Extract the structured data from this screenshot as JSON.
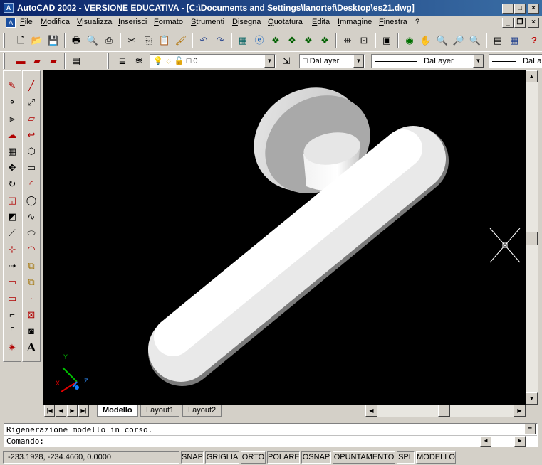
{
  "window": {
    "title": "AutoCAD 2002 - VERSIONE EDUCATIVA - [C:\\Documents and Settings\\lanortef\\Desktop\\es21.dwg]",
    "app_icon": "A"
  },
  "menu": [
    "File",
    "Modifica",
    "Visualizza",
    "Inserisci",
    "Formato",
    "Strumenti",
    "Disegna",
    "Quotatura",
    "Edita",
    "Immagine",
    "Finestra",
    "?"
  ],
  "standard_toolbar": {
    "icons": [
      "new-icon",
      "open-icon",
      "save-icon",
      "print-icon",
      "preview-icon",
      "plot-icon",
      "cut-icon",
      "copy-icon",
      "paste-icon",
      "match-prop-icon",
      "undo-icon",
      "redo-icon",
      "design-center-icon",
      "web-icon",
      "3d-orbit-icon",
      "pan-icon",
      "zoom-icon",
      "properties-icon",
      "help-icon"
    ]
  },
  "layer_toolbar": {
    "layer_value": "0",
    "color_value": "DaLayer",
    "linetype_value": "DaLayer",
    "lineweight_value": "DaLa"
  },
  "draw_tools": [
    "line-icon",
    "construction-line-icon",
    "multiline-icon",
    "polyline-icon",
    "polygon-icon",
    "rectangle-icon",
    "arc-icon",
    "circle-icon",
    "revcloud-icon",
    "spline-icon",
    "ellipse-icon",
    "ellipse-arc-icon",
    "insert-block-icon",
    "make-block-icon",
    "point-icon",
    "hatch-icon",
    "region-icon",
    "table-icon",
    "mtext-icon"
  ],
  "modify_tools": [
    "erase-icon",
    "copy-object-icon",
    "mirror-icon",
    "offset-icon",
    "array-icon",
    "move-icon",
    "rotate-icon",
    "scale-icon",
    "stretch-icon",
    "trim-icon",
    "extend-icon",
    "break-icon",
    "chamfer-icon",
    "fillet-icon",
    "explode-icon"
  ],
  "ucs": {
    "y": "Y",
    "z": "Z",
    "x": "X"
  },
  "tabs": [
    "Modello",
    "Layout1",
    "Layout2"
  ],
  "command": {
    "history": "Rigenerazione modello in corso.",
    "prompt": "Comando:"
  },
  "status": {
    "coordinates": "-233.1928, -234.4660, 0.0000",
    "buttons": [
      "SNAP",
      "GRIGLIA",
      "ORTO",
      "POLARE",
      "OSNAP",
      "OPUNTAMENTO",
      "SPL",
      "MODELLO"
    ]
  },
  "colors": {
    "title_start": "#0a246a",
    "title_end": "#3a6ea5",
    "canvas": "#000000",
    "chrome": "#d4d0c8"
  }
}
